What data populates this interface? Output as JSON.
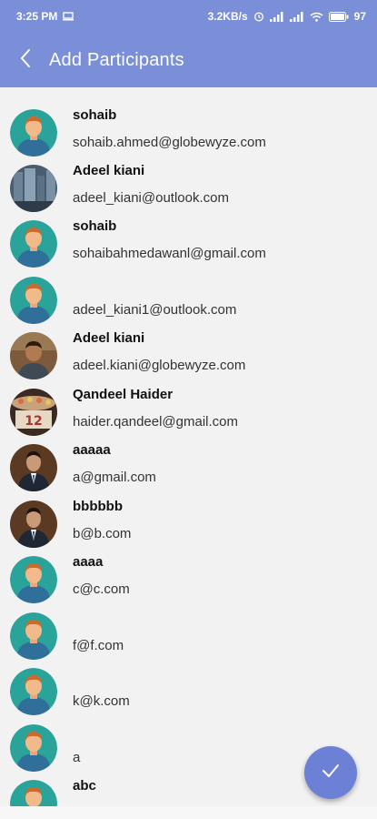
{
  "status_bar": {
    "time": "3:25 PM",
    "speed": "3.2KB/s",
    "battery": "97"
  },
  "header": {
    "title": "Add Participants",
    "back_icon": "chevron-left-icon"
  },
  "colors": {
    "primary": "#7b8fd8",
    "fab": "#6c80d6",
    "avatar_bg": "#2aa39b"
  },
  "participants": [
    {
      "name": "sohaib",
      "email": "sohaib.ahmed@globewyze.com",
      "avatar": "default"
    },
    {
      "name": "Adeel kiani",
      "email": "adeel_kiani@outlook.com",
      "avatar": "photo-city"
    },
    {
      "name": "sohaib",
      "email": "sohaibahmedawanl@gmail.com",
      "avatar": "default"
    },
    {
      "name": "",
      "email": "adeel_kiani1@outlook.com",
      "avatar": "default"
    },
    {
      "name": "Adeel kiani",
      "email": "adeel.kiani@globewyze.com",
      "avatar": "photo-man"
    },
    {
      "name": "Qandeel Haider",
      "email": "haider.qandeel@gmail.com",
      "avatar": "photo-cake"
    },
    {
      "name": "aaaaa",
      "email": "a@gmail.com",
      "avatar": "photo-suit"
    },
    {
      "name": "bbbbbb",
      "email": "b@b.com",
      "avatar": "photo-suit"
    },
    {
      "name": "aaaa",
      "email": "c@c.com",
      "avatar": "default"
    },
    {
      "name": "",
      "email": "f@f.com",
      "avatar": "default"
    },
    {
      "name": "",
      "email": "k@k.com",
      "avatar": "default"
    },
    {
      "name": "",
      "email": "a",
      "avatar": "default"
    },
    {
      "name": "abc",
      "email": "",
      "avatar": "default"
    }
  ],
  "fab": {
    "icon": "check-icon"
  }
}
